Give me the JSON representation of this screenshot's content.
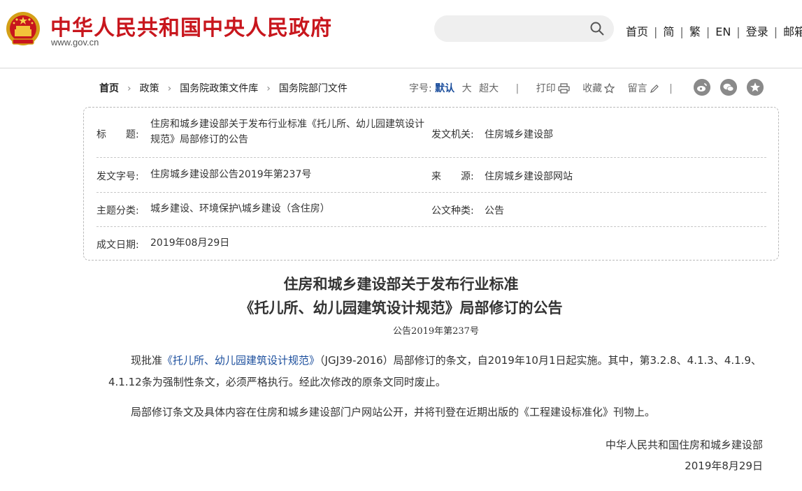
{
  "header": {
    "site_title": "中华人民共和国中央人民政府",
    "site_url": "www.gov.cn",
    "search_placeholder": "",
    "nav": [
      "首页",
      "简",
      "繁",
      "EN",
      "登录",
      "邮箱"
    ]
  },
  "breadcrumb": [
    "首页",
    "政策",
    "国务院政策文件库",
    "国务院部门文件"
  ],
  "tools": {
    "font_label": "字号:",
    "font_default": "默认",
    "font_large": "大",
    "font_xlarge": "超大",
    "print": "打印",
    "favorite": "收藏",
    "comment": "留言"
  },
  "info": {
    "title_label": "标　　题:",
    "title_value": "住房和城乡建设部关于发布行业标准《托儿所、幼儿园建筑设计规范》局部修订的公告",
    "issuer_label": "发文机关:",
    "issuer_value": "住房城乡建设部",
    "docno_label": "发文字号:",
    "docno_value": "住房城乡建设部公告2019年第237号",
    "source_label": "来　　源:",
    "source_value": "住房城乡建设部网站",
    "topic_label": "主题分类:",
    "topic_value": "城乡建设、环境保护\\城乡建设（含住房）",
    "type_label": "公文种类:",
    "type_value": "公告",
    "date_label": "成文日期:",
    "date_value": "2019年08月29日"
  },
  "article": {
    "title_line1": "住房和城乡建设部关于发布行业标准",
    "title_line2": "《托儿所、幼儿园建筑设计规范》局部修订的公告",
    "doc_number": "公告2019年第237号",
    "p1_before": "现批准",
    "p1_link": "《托儿所、幼儿园建筑设计规范》",
    "p1_after": "（JGJ39-2016）局部修订的条文，自2019年10月1日起实施。其中，第3.2.8、4.1.3、4.1.9、4.1.12条为强制性条文，必须严格执行。经此次修改的原条文同时废止。",
    "p2": "局部修订条文及具体内容在住房和城乡建设部门户网站公开，并将刊登在近期出版的《工程建设标准化》刊物上。",
    "sign_org": "中华人民共和国住房和城乡建设部",
    "sign_date": "2019年8月29日"
  },
  "colors": {
    "brand_red": "#c8161d",
    "link_blue": "#1a4d9c"
  }
}
